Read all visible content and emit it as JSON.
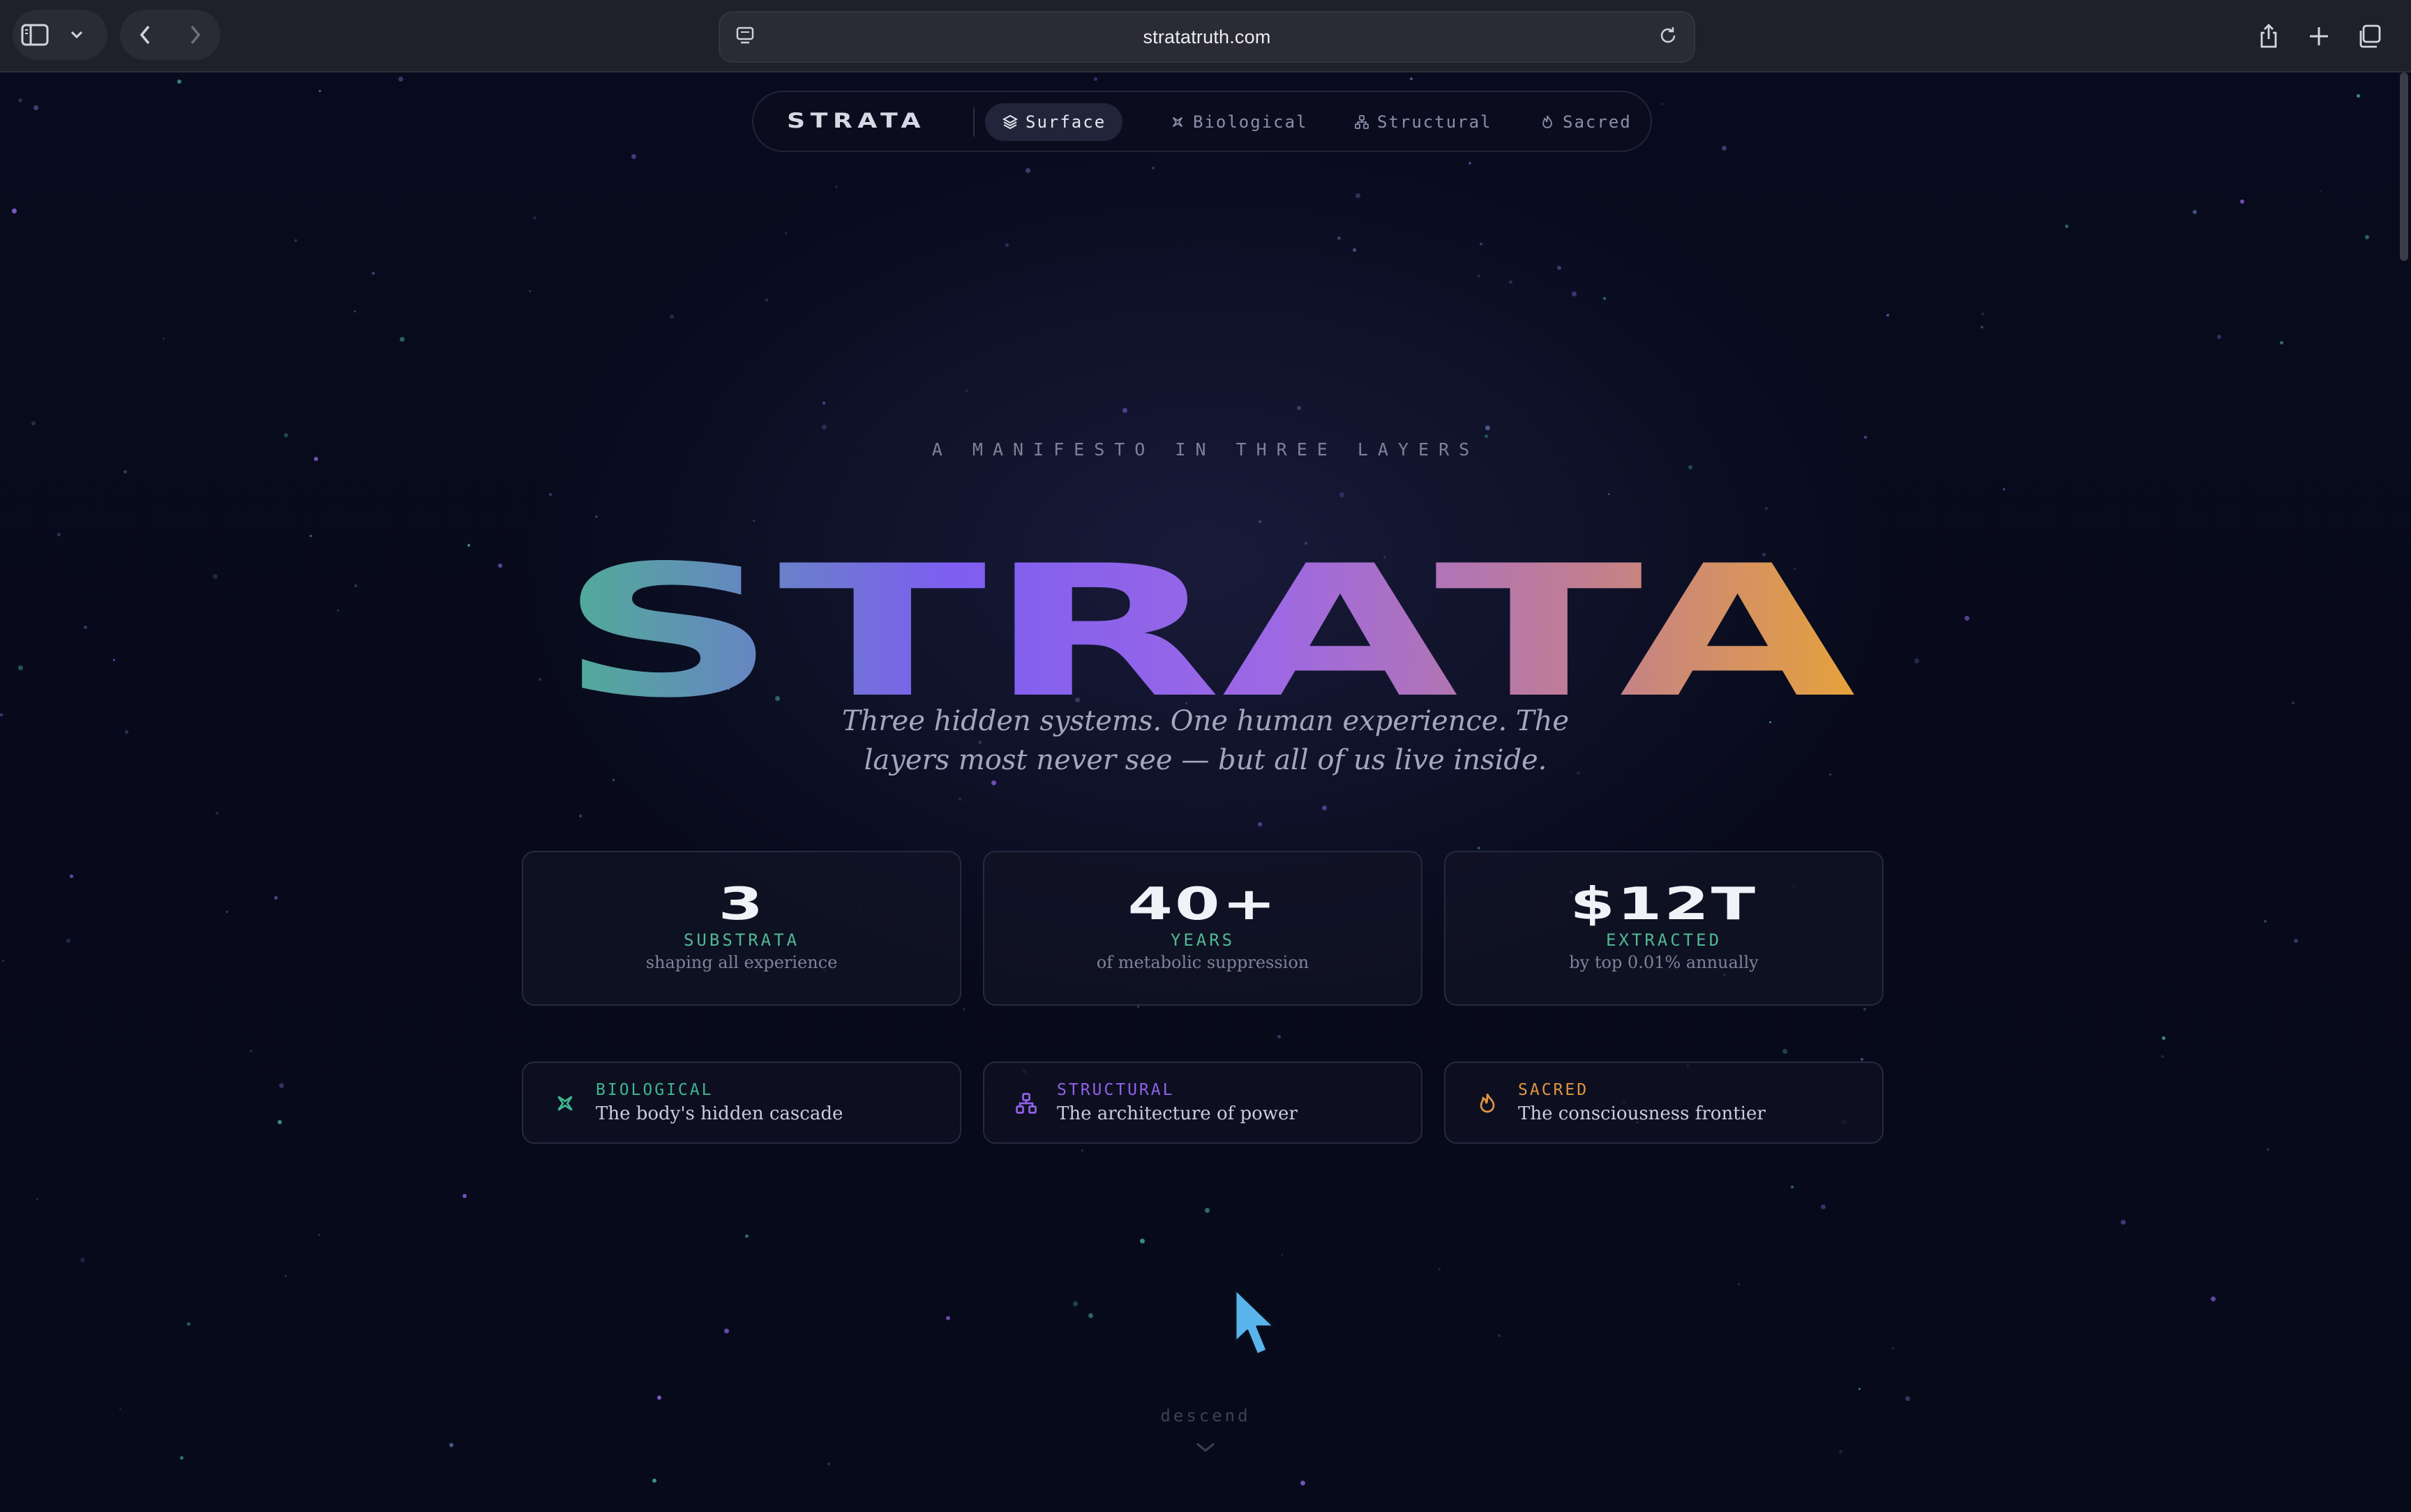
{
  "browser": {
    "url": "stratatruth.com"
  },
  "nav": {
    "brand": "STRATA",
    "items": [
      {
        "label": "Surface",
        "icon": "layers-icon",
        "active": true
      },
      {
        "label": "Biological",
        "icon": "sparkle-icon",
        "active": false
      },
      {
        "label": "Structural",
        "icon": "hierarchy-icon",
        "active": false
      },
      {
        "label": "Sacred",
        "icon": "flame-icon",
        "active": false
      }
    ]
  },
  "hero": {
    "eyebrow": "A MANIFESTO IN THREE LAYERS",
    "title": "STRATA",
    "tagline_line1": "Three hidden systems. One human experience. The",
    "tagline_line2": "layers most never see — but all of us live inside."
  },
  "stats": [
    {
      "value": "3",
      "label": "SUBSTRATA",
      "sub": "shaping all experience"
    },
    {
      "value": "40+",
      "label": "YEARS",
      "sub": "of metabolic suppression"
    },
    {
      "value": "$12T",
      "label": "EXTRACTED",
      "sub": "by top 0.01% annually"
    }
  ],
  "layers": [
    {
      "title": "BIOLOGICAL",
      "desc": "The body's hidden cascade",
      "icon": "sparkle-icon",
      "color": "#3fb68f"
    },
    {
      "title": "STRUCTURAL",
      "desc": "The architecture of power",
      "icon": "hierarchy-icon",
      "color": "#8f62e6"
    },
    {
      "title": "SACRED",
      "desc": "The consciousness frontier",
      "icon": "flame-icon",
      "color": "#e0963e"
    }
  ],
  "footer": {
    "descend": "descend"
  },
  "colors": {
    "background": "#070a1a",
    "accent_green": "#52b893",
    "gradient": [
      "#4fae94",
      "#7d5ef0",
      "#9d68e4",
      "#d1885f",
      "#e6a23a"
    ]
  }
}
